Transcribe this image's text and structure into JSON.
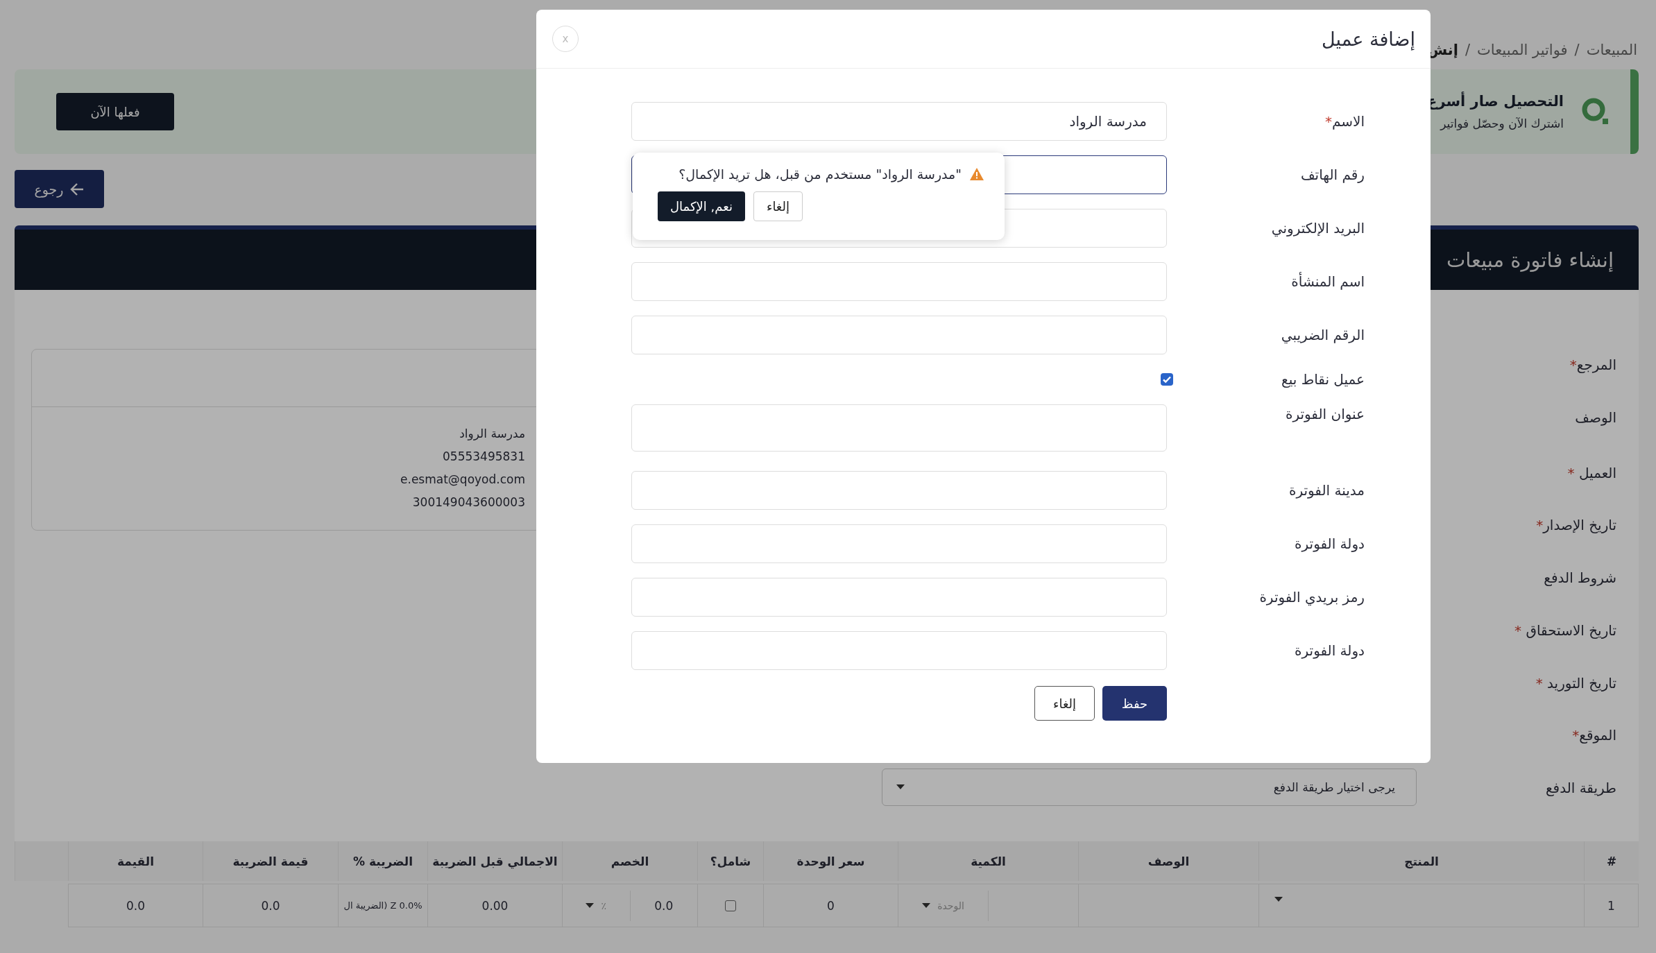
{
  "breadcrumb": [
    {
      "text": "المبيعات",
      "kind": "link"
    },
    {
      "text": "/",
      "kind": "separator"
    },
    {
      "text": "فواتير المبيعات",
      "kind": "link"
    },
    {
      "text": "/",
      "kind": "separator"
    },
    {
      "text": "إنش",
      "kind": "current"
    }
  ],
  "banner": {
    "title": "التحصيل صار أسرع",
    "subtitle": "اشترك الآن وحصّل فواتير",
    "button": "فعلها الآن"
  },
  "back_button": "رجوع",
  "page_title": "إنشاء فاتورة مبيعات",
  "customer_card": {
    "lines": [
      "مدرسة الرواد",
      "05553495831",
      "e.esmat@qoyod.com",
      "300149043600003"
    ]
  },
  "invoice_fields": [
    {
      "label": "المرجع",
      "mark": "*"
    },
    {
      "label": "الوصف"
    },
    {
      "label": "العميل",
      "mark": " *"
    },
    {
      "label": "تاريخ الإصدار",
      "mark": "*"
    },
    {
      "label": "شروط الدفع"
    },
    {
      "label": "تاريخ الاستحقاق",
      "mark": " *"
    },
    {
      "label": "تاريخ التوريد",
      "mark": " *"
    },
    {
      "label": "الموقع",
      "mark": "*"
    },
    {
      "label": "طريقة الدفع"
    }
  ],
  "payment_method": {
    "placeholder": "يرجى اختيار طريقة الدفع"
  },
  "table": {
    "columns": [
      "#",
      "المنتج",
      "الوصف",
      "الكمية",
      "سعر الوحدة",
      "شامل؟",
      "الخصم",
      "الاجمالي قبل الضريبة",
      "الضريبة %",
      "قيمة الضريبة",
      "القيمة"
    ],
    "rows": [
      {
        "number": "1",
        "unit": "الوحدة",
        "unit_price": "0",
        "inclusive": false,
        "discount": "0.0",
        "discount_type": "٪",
        "subtotal": "0.00",
        "tax": "0.0% Z (الضريبة ال",
        "tax_amount": "0.0",
        "total": "0.0"
      }
    ]
  },
  "modal": {
    "title": "إضافة عميل",
    "close": "x",
    "fields": [
      {
        "kind": "input",
        "label": "الاسم",
        "mark": "*",
        "value": "مدرسة الرواد",
        "focused": false
      },
      {
        "kind": "input",
        "label": "رقم الهاتف",
        "focused": true
      },
      {
        "kind": "input",
        "label": "البريد الإلكتروني",
        "focused": false
      },
      {
        "kind": "input",
        "label": "اسم المنشأة",
        "focused": false
      },
      {
        "kind": "input",
        "label": "الرقم الضريبي",
        "focused": false
      },
      {
        "kind": "checkbox",
        "label": "عميل نقاط بيع",
        "checked": true
      },
      {
        "kind": "textarea",
        "label": "عنوان الفوترة",
        "focused": false
      },
      {
        "kind": "input",
        "label": "مدينة الفوترة",
        "focused": false
      },
      {
        "kind": "input",
        "label": "دولة الفوترة",
        "focused": false
      },
      {
        "kind": "input",
        "label": "رمز بريدي الفوترة",
        "focused": false
      },
      {
        "kind": "input",
        "label": "دولة الفوترة",
        "focused": false
      }
    ],
    "buttons": [
      {
        "label": "حفظ",
        "primary": true
      },
      {
        "label": "إلغاء",
        "primary": false
      }
    ]
  },
  "popover": {
    "message": "\"مدرسة الرواد\" مستخدم من قبل، هل تريد الإكمال؟",
    "buttons": [
      {
        "label": "إلغاء",
        "primary": false
      },
      {
        "label": "نعم, الإكمال",
        "primary": true
      }
    ]
  }
}
